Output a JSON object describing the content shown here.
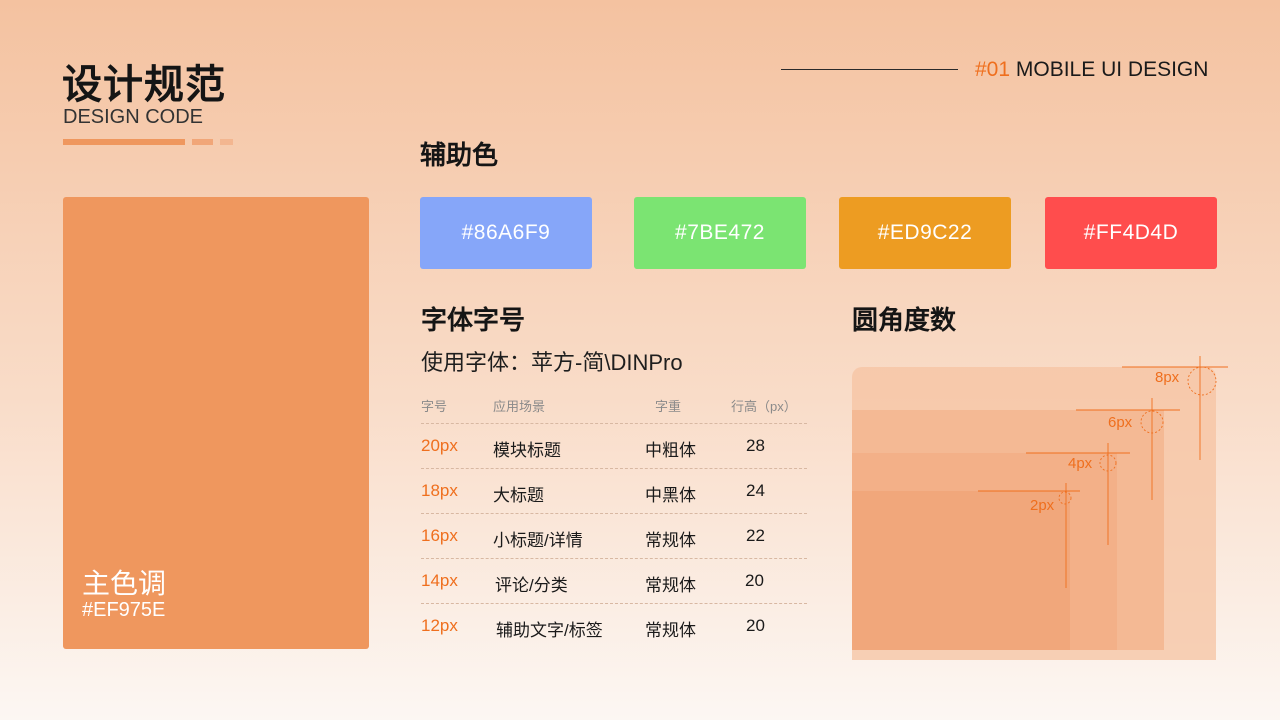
{
  "header": {
    "title": "设计规范",
    "subtitle": "DESIGN CODE",
    "tag_number": "#01",
    "tag_text": " MOBILE UI DESIGN"
  },
  "main_color": {
    "name": "主色调",
    "hex": "#EF975E",
    "color": "#EF975E"
  },
  "aux_colors": {
    "title": "辅助色",
    "items": [
      {
        "hex": "#86A6F9",
        "color": "#86A6F9"
      },
      {
        "hex": "#7BE472",
        "color": "#7BE472"
      },
      {
        "hex": "#ED9C22",
        "color": "#ED9C22"
      },
      {
        "hex": "#FF4D4D",
        "color": "#FF4D4D"
      }
    ]
  },
  "fonts": {
    "title": "字体字号",
    "font_use": "使用字体：苹方-简\\DINPro",
    "headers": [
      "字号",
      "应用场景",
      "字重",
      "行高（px）"
    ],
    "rows": [
      [
        "20px",
        "模块标题",
        "中粗体",
        "28"
      ],
      [
        "18px",
        "大标题",
        "中黑体",
        "24"
      ],
      [
        "16px",
        "小标题/详情",
        "常规体",
        "22"
      ],
      [
        "14px",
        "评论/分类",
        "常规体",
        "20"
      ],
      [
        "12px",
        "辅助文字/标签",
        "常规体",
        "20"
      ]
    ]
  },
  "radius": {
    "title": "圆角度数",
    "labels": [
      "8px",
      "6px",
      "4px",
      "2px"
    ]
  },
  "colors": {
    "accent": "#EF6F1E",
    "primary": "#EF975E"
  }
}
